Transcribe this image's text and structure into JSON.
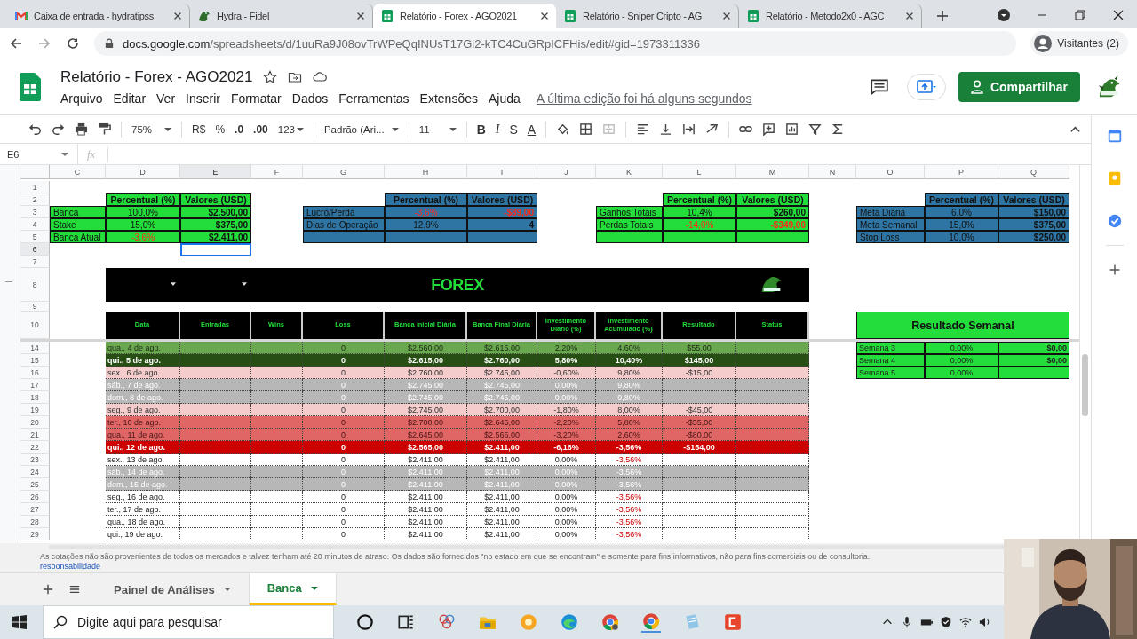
{
  "browser": {
    "tabs": [
      {
        "title": "Caixa de entrada - hydratipss",
        "selected": false
      },
      {
        "title": "Hydra - Fidel",
        "selected": false
      },
      {
        "title": "Relatório - Forex - AGO2021",
        "selected": true
      },
      {
        "title": "Relatório - Sniper Cripto - AG",
        "selected": false
      },
      {
        "title": "Relatório - Metodo2x0 - AGC",
        "selected": false
      }
    ],
    "url_domain": "docs.google.com",
    "url_path": "/spreadsheets/d/1uuRa9J08ovTrWPeQqINUsT17Gi2-kTC4CuGRpICFHis/edit#gid=1973311336",
    "profile": "Visitantes (2)"
  },
  "document": {
    "title": "Relatório - Forex - AGO2021",
    "menus": [
      "Arquivo",
      "Editar",
      "Ver",
      "Inserir",
      "Formatar",
      "Dados",
      "Ferramentas",
      "Extensões",
      "Ajuda"
    ],
    "last_edit": "A última edição foi há alguns segundos",
    "share_button": "Compartilhar"
  },
  "toolbar": {
    "zoom": "75%",
    "currency": "R$",
    "percent": "%",
    "decimals_less": ".0",
    "decimals_more": ".00",
    "number_format": "123",
    "font": "Padrão (Ari...",
    "font_size": "11",
    "bold": "B",
    "italic": "I",
    "strike": "S",
    "text_color": "A"
  },
  "formula_bar": {
    "cell_ref": "E6",
    "fx": "fx"
  },
  "sheet": {
    "columns": [
      {
        "label": "C",
        "selected": false
      },
      {
        "label": "D",
        "selected": false
      },
      {
        "label": "E",
        "selected": true
      },
      {
        "label": "F",
        "selected": false
      },
      {
        "label": "G",
        "selected": false
      },
      {
        "label": "H",
        "selected": false
      },
      {
        "label": "I",
        "selected": false
      },
      {
        "label": "J",
        "selected": false
      },
      {
        "label": "K",
        "selected": false
      },
      {
        "label": "L",
        "selected": false
      },
      {
        "label": "M",
        "selected": false
      },
      {
        "label": "N",
        "selected": false
      },
      {
        "label": "O",
        "selected": false
      },
      {
        "label": "P",
        "selected": false
      },
      {
        "label": "Q",
        "selected": false
      }
    ],
    "row_headers": [
      {
        "label": "1",
        "selected": false
      },
      {
        "label": "2",
        "selected": false
      },
      {
        "label": "3",
        "selected": false
      },
      {
        "label": "4",
        "selected": false
      },
      {
        "label": "5",
        "selected": false
      },
      {
        "label": "6",
        "selected": true
      },
      {
        "label": "7",
        "selected": false
      },
      {
        "label": "8",
        "selected": false
      },
      {
        "label": "9",
        "selected": false
      },
      {
        "label": "10",
        "selected": false
      }
    ]
  },
  "summary_tables": [
    {
      "color": "#22dd3a",
      "headers": [
        "Percentual (%)",
        "Valores (USD)"
      ],
      "rows": [
        {
          "label": "Banca",
          "percent": "100,0%",
          "value": "$2.500,00",
          "percent_alert": false,
          "value_alert": false
        },
        {
          "label": "Stake",
          "percent": "15,0%",
          "value": "$375,00",
          "percent_alert": false,
          "value_alert": false
        },
        {
          "label": "Banca Atual",
          "percent": "-3,6%",
          "value": "$2.411,00",
          "percent_alert": true,
          "value_alert": false
        }
      ]
    },
    {
      "color": "#2e75a3",
      "headers": [
        "Percentual (%)",
        "Valores (USD)"
      ],
      "rows": [
        {
          "label": "Lucro/Perda",
          "percent": "-3,6%",
          "value": "-$89,00",
          "percent_alert": true,
          "value_alert": true
        },
        {
          "label": "Dias de Operação",
          "percent": "12,9%",
          "value": "4",
          "percent_alert": false,
          "value_alert": false
        }
      ]
    },
    {
      "color": "#22dd3a",
      "headers": [
        "Percentual (%)",
        "Valores (USD)"
      ],
      "rows": [
        {
          "label": "Ganhos Totais",
          "percent": "10,4%",
          "value": "$260,00",
          "percent_alert": false,
          "value_alert": false
        },
        {
          "label": "Perdas Totais",
          "percent": "-14,0%",
          "value": "-$349,00",
          "percent_alert": true,
          "value_alert": true
        }
      ]
    },
    {
      "color": "#2e75a3",
      "headers": [
        "Percentual (%)",
        "Valores (USD)"
      ],
      "rows": [
        {
          "label": "Meta Diária",
          "percent": "6,0%",
          "value": "$150,00",
          "percent_alert": false,
          "value_alert": false
        },
        {
          "label": "Meta Semanal",
          "percent": "15,0%",
          "value": "$375,00",
          "percent_alert": false,
          "value_alert": false
        },
        {
          "label": "Stop Loss",
          "percent": "10,0%",
          "value": "$250,00",
          "percent_alert": false,
          "value_alert": false
        }
      ]
    }
  ],
  "forex_table": {
    "banner": "FOREX",
    "columns": [
      "Data",
      "Entradas",
      "Wins",
      "Loss",
      "Banca Inicial Diária",
      "Banca Final Diária",
      "Investimento Diário (%)",
      "Investimento Acumulado (%)",
      "Resultado",
      "Status"
    ],
    "rows": [
      {
        "row": "14",
        "kind": "gain",
        "date": "qua., 4 de ago.",
        "loss": "0",
        "start": "$2.560,00",
        "end": "$2.615,00",
        "daily": "2,20%",
        "accumulated": "4,60%",
        "result": "$55,00"
      },
      {
        "row": "15",
        "kind": "gain-strong",
        "date": "qui., 5 de ago.",
        "loss": "0",
        "start": "$2.615,00",
        "end": "$2.760,00",
        "daily": "5,80%",
        "accumulated": "10,40%",
        "result": "$145,00"
      },
      {
        "row": "16",
        "kind": "loss-light",
        "date": "sex., 6 de ago.",
        "loss": "0",
        "start": "$2.760,00",
        "end": "$2.745,00",
        "daily": "-0,60%",
        "accumulated": "9,80%",
        "result": "-$15,00"
      },
      {
        "row": "17",
        "kind": "weekend",
        "date": "sáb., 7 de ago.",
        "loss": "0",
        "start": "$2.745,00",
        "end": "$2.745,00",
        "daily": "0,00%",
        "accumulated": "9,80%"
      },
      {
        "row": "18",
        "kind": "weekend",
        "date": "dom., 8 de ago.",
        "loss": "0",
        "start": "$2.745,00",
        "end": "$2.745,00",
        "daily": "0,00%",
        "accumulated": "9,80%"
      },
      {
        "row": "19",
        "kind": "loss-light",
        "date": "seg., 9 de ago.",
        "loss": "0",
        "start": "$2.745,00",
        "end": "$2.700,00",
        "daily": "-1,80%",
        "accumulated": "8,00%",
        "result": "-$45,00"
      },
      {
        "row": "20",
        "kind": "loss",
        "date": "ter., 10 de ago.",
        "loss": "0",
        "start": "$2.700,00",
        "end": "$2.645,00",
        "daily": "-2,20%",
        "accumulated": "5,80%",
        "result": "-$55,00"
      },
      {
        "row": "21",
        "kind": "loss",
        "date": "qua., 11 de ago.",
        "loss": "0",
        "start": "$2.645,00",
        "end": "$2.565,00",
        "daily": "-3,20%",
        "accumulated": "2,60%",
        "result": "-$80,00"
      },
      {
        "row": "22",
        "kind": "loss-strong",
        "date": "qui., 12 de ago.",
        "loss": "0",
        "start": "$2.565,00",
        "end": "$2.411,00",
        "daily": "-6,16%",
        "accumulated": "-3,56%",
        "result": "-$154,00"
      },
      {
        "row": "23",
        "kind": "pending",
        "date": "sex., 13 de ago.",
        "loss": "0",
        "start": "$2.411,00",
        "end": "$2.411,00",
        "daily": "0,00%",
        "accumulated": "-3,56%"
      },
      {
        "row": "24",
        "kind": "weekend",
        "date": "sáb., 14 de ago.",
        "loss": "0",
        "start": "$2.411,00",
        "end": "$2.411,00",
        "daily": "0,00%",
        "accumulated": "-3,56%"
      },
      {
        "row": "25",
        "kind": "weekend",
        "date": "dom., 15 de ago.",
        "loss": "0",
        "start": "$2.411,00",
        "end": "$2.411,00",
        "daily": "0,00%",
        "accumulated": "-3,56%"
      },
      {
        "row": "26",
        "kind": "pending",
        "date": "seg., 16 de ago.",
        "loss": "0",
        "start": "$2.411,00",
        "end": "$2.411,00",
        "daily": "0,00%",
        "accumulated": "-3,56%"
      },
      {
        "row": "27",
        "kind": "pending",
        "date": "ter., 17 de ago.",
        "loss": "0",
        "start": "$2.411,00",
        "end": "$2.411,00",
        "daily": "0,00%",
        "accumulated": "-3,56%"
      },
      {
        "row": "28",
        "kind": "pending",
        "date": "qua., 18 de ago.",
        "loss": "0",
        "start": "$2.411,00",
        "end": "$2.411,00",
        "daily": "0,00%",
        "accumulated": "-3,56%"
      },
      {
        "row": "29",
        "kind": "pending",
        "date": "qui., 19 de ago.",
        "loss": "0",
        "start": "$2.411,00",
        "end": "$2.411,00",
        "daily": "0,00%",
        "accumulated": "-3,56%"
      }
    ]
  },
  "weekly": {
    "title": "Resultado Semanal",
    "rows": [
      {
        "label": "Semana 3",
        "percent": "0,00%",
        "value": "$0,00"
      },
      {
        "label": "Semana 4",
        "percent": "0,00%",
        "value": "$0,00"
      },
      {
        "label": "Semana 5",
        "percent": "0,00%"
      }
    ]
  },
  "disclaimer": "As cotações não são provenientes de todos os mercados e talvez tenham até 20 minutos de atraso. Os dados são fornecidos \"no estado em que se encontram\" e somente para fins informativos, não para fins comerciais ou de consultoria.",
  "disclaimer_link": "responsabilidade",
  "sheet_tabs": [
    {
      "label": "Painel de Análises",
      "selected": false
    },
    {
      "label": "Banca",
      "selected": true
    }
  ],
  "taskbar": {
    "search_placeholder": "Digite aqui para pesquisar"
  }
}
